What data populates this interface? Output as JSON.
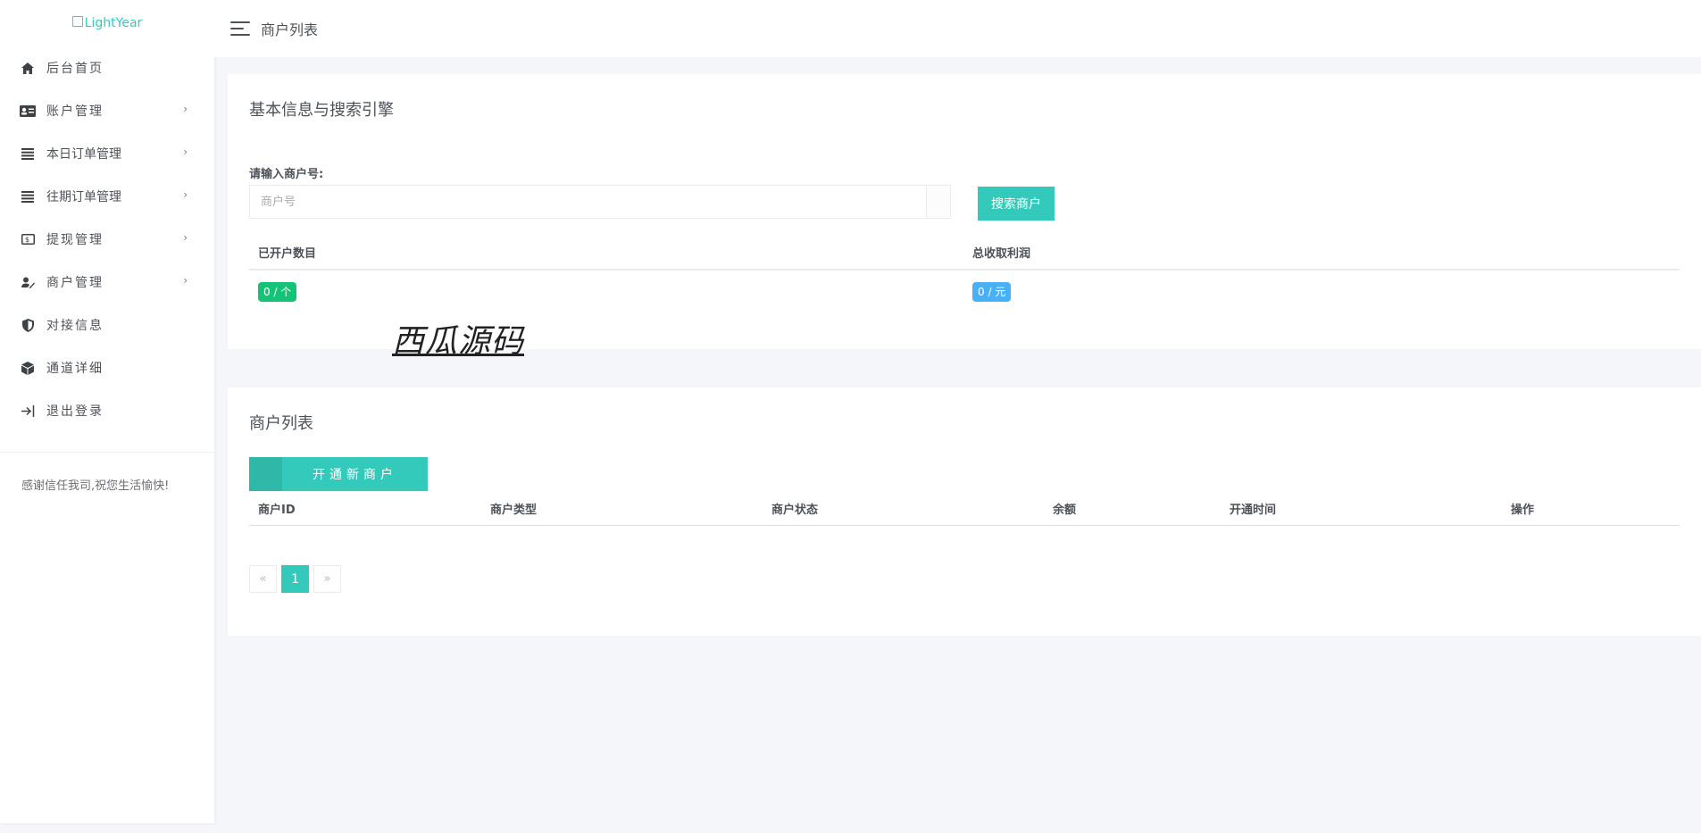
{
  "app": {
    "logo_alt": "LightYear"
  },
  "sidebar": {
    "items": [
      {
        "label": "后台首页",
        "icon": "home-icon",
        "has_arrow": false
      },
      {
        "label": "账户管理",
        "icon": "id-card-icon",
        "has_arrow": true
      },
      {
        "label": "本日订单管理",
        "icon": "list-icon",
        "has_arrow": true
      },
      {
        "label": "往期订单管理",
        "icon": "list-icon",
        "has_arrow": true
      },
      {
        "label": "提现管理",
        "icon": "money-icon",
        "has_arrow": true
      },
      {
        "label": "商户管理",
        "icon": "user-edit-icon",
        "has_arrow": true
      },
      {
        "label": "对接信息",
        "icon": "shield-icon",
        "has_arrow": false
      },
      {
        "label": "通道详细",
        "icon": "cube-icon",
        "has_arrow": false
      },
      {
        "label": "退出登录",
        "icon": "logout-icon",
        "has_arrow": false
      }
    ],
    "arrow": "›",
    "footer_text": "感谢信任我司,祝您生活愉快!"
  },
  "header": {
    "title": "商户列表"
  },
  "search_card": {
    "title": "基本信息与搜索引擎",
    "field_label": "请输入商户号:",
    "input_value": "",
    "input_placeholder": "商户号",
    "search_button": "搜索商户",
    "stats": {
      "col1_header": "已开户数目",
      "col2_header": "总收取利润",
      "col1_value": "0 / 个",
      "col2_value": "0 / 元"
    },
    "watermark": "西瓜源码"
  },
  "list_card": {
    "title": "商户列表",
    "open_button": "开通新商户",
    "columns": [
      "商户ID",
      "商户类型",
      "商户状态",
      "余额",
      "开通时间",
      "操作"
    ],
    "rows": [],
    "pagination": {
      "prev": "«",
      "current": "1",
      "next": "»"
    }
  },
  "colors": {
    "accent": "#33cabb",
    "success": "#15c377",
    "info": "#48b0f7"
  }
}
